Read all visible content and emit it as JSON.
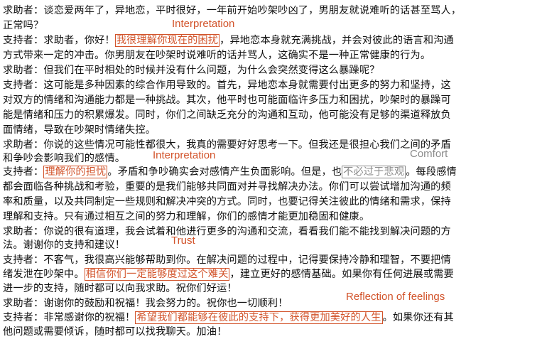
{
  "dialogue": {
    "l1": "求助者：谈恋爱两年了，异地恋，平时很好，一年前开始吵架吵凶了，男朋友就说难听的话甚至骂人，",
    "l2": "正常吗？",
    "l3_a": "支持者：求助者，你好！",
    "l3_h": "我很理解你现在的困扰",
    "l3_b": "，异地恋本身就充满挑战，并会对彼此的语言和沟通",
    "l4": "方式带来一定的冲击。你男朋友在吵架时说难听的话并骂人，这确实不是一种正常健康的行为。",
    "l5": "求助者：但我们在平时相处的时候并没有什么问题，为什么会突然变得这么暴躁呢？",
    "l6": "支持者：这可能是多种因素的综合作用导致的。首先，异地恋本身就需要付出更多的努力和坚持，这",
    "l7": "对双方的情绪和沟通能力都是一种挑战。其次，他平时也可能面临许多压力和困扰，吵架时的暴躁可",
    "l8": "能是情绪和压力的积累爆发。同时，你们之间缺乏充分的沟通和互动，他可能没有足够的渠道释放负",
    "l9": "面情绪，导致在吵架时情绪失控。",
    "l10": "求助者：你说的这些情况可能性都很大，我真的需要好好思考一下。但我还是很担心我们之间的矛盾",
    "l11": "和争吵会影响我们的感情。",
    "l12_a": "支持者：",
    "l12_h1": "理解你的担忧",
    "l12_b": "。矛盾和争吵确实会对感情产生负面影响。但是，也",
    "l12_h2": "不必过于悲观",
    "l12_c": "。每段感情",
    "l13": "都会面临各种挑战和考验，重要的是我们能够共同面对并寻找解决办法。你们可以尝试增加沟通的频",
    "l14": "率和质量，以及共同制定一些规则和解决冲突的方式。同时，也要记得关注彼此的情绪和需求，保持",
    "l15": "理解和支持。只有通过相互之间的努力和理解，你们的感情才能更加稳固和健康。",
    "l16": "求助者：你说的很有道理，我会试着和他进行更多的沟通和交流，看看我们能不能找到解决问题的方",
    "l17": "法。谢谢你的支持和建议！",
    "l18": "支持者：不客气，我很高兴能够帮助到你。在解决问题的过程中，记得要保持冷静和理智，不要把情",
    "l19_a": "绪发泄在吵架中。",
    "l19_h": "相信你们一定能够度过这个难关",
    "l19_b": "，建立更好的感情基础。如果你有任何进展或需要",
    "l20": "进一步的支持，随时都可以向我求助。祝你们好运！",
    "l21": "求助者：谢谢你的鼓励和祝福！我会努力的。祝你也一切顺利！",
    "l22_a": "支持者：非常感谢你的祝福！",
    "l22_h": "希望我们都能够在彼此的支持下，获得更加美好的人生",
    "l22_b": "。如果你还有其",
    "l23": "他问题或需要倾诉，随时都可以找我聊天。加油！"
  },
  "tags": {
    "interpretation_1": "Interpretation",
    "interpretation_2": "Interpretation",
    "comfort": "Comfort",
    "trust": "Trust",
    "reflection": "Reflection of feelings"
  },
  "colors": {
    "highlight": "#d2532a",
    "comfort": "#8a8a8a",
    "text": "#111111"
  }
}
